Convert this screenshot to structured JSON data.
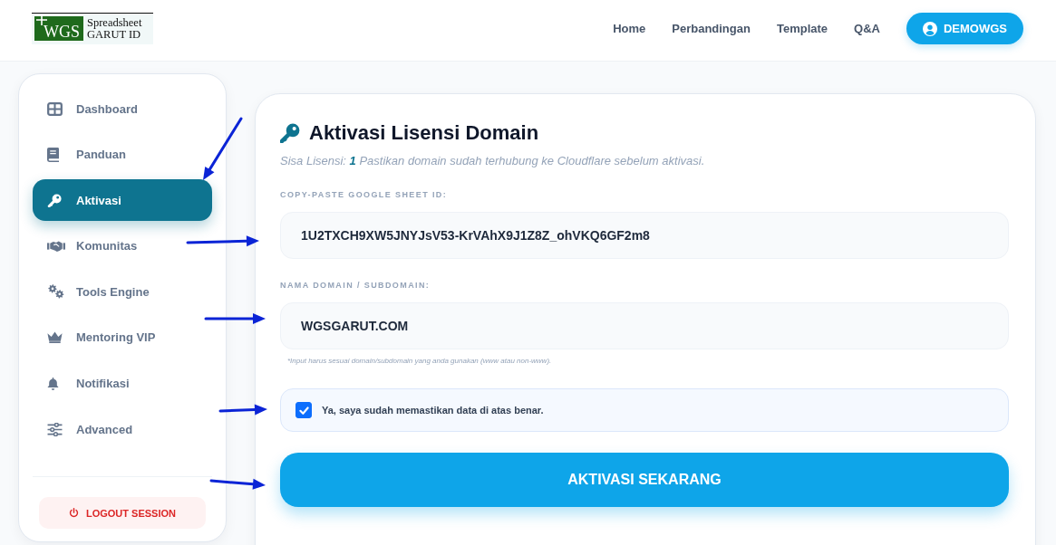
{
  "header": {
    "logo": {
      "mark": "WGS",
      "lines": [
        "Spreadsheet",
        "GARUT ID"
      ]
    },
    "nav": [
      "Home",
      "Perbandingan",
      "Template",
      "Q&A"
    ],
    "user_button": "DEMOWGS"
  },
  "sidebar": {
    "items": [
      {
        "label": "Dashboard",
        "selected": false
      },
      {
        "label": "Panduan",
        "selected": false
      },
      {
        "label": "Aktivasi",
        "selected": true
      },
      {
        "label": "Komunitas",
        "selected": false
      },
      {
        "label": "Tools Engine",
        "selected": false
      },
      {
        "label": "Mentoring VIP",
        "selected": false
      },
      {
        "label": "Notifikasi",
        "selected": false
      },
      {
        "label": "Advanced",
        "selected": false
      }
    ],
    "logout": "LOGOUT SESSION"
  },
  "form": {
    "title": "Aktivasi Lisensi Domain",
    "subtitle": "Sisa Lisensi: **1** Pastikan domain sudah terhubung ke Cloudflare sebelum aktivasi.",
    "fields": [
      {
        "label": "COPY-PASTE GOOGLE SHEET ID:",
        "value": "1U2TXCH9XW5JNYJsV53-KrVAhX9J1Z8Z_ohVKQ6GF2m8"
      },
      {
        "label": "NAMA DOMAIN / SUBDOMAIN:",
        "value": "WGSGARUT.COM",
        "hint": "*Input harus sesuai domain/subdomain yang anda gunakan (www atau non-www)."
      }
    ],
    "confirm": {
      "label": "Ya, saya sudah memastikan data di atas benar.",
      "checked": true
    },
    "submit": "AKTIVASI SEKARANG"
  }
}
